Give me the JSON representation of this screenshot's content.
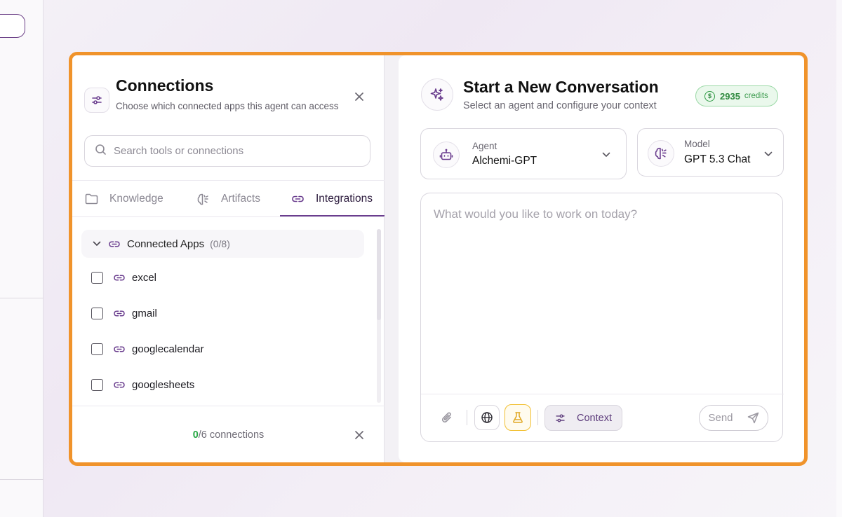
{
  "connections": {
    "title": "Connections",
    "subtitle": "Choose which connected apps this agent can access",
    "search_placeholder": "Search tools or connections",
    "tabs": [
      {
        "label": "Knowledge",
        "icon": "folder-icon",
        "active": false
      },
      {
        "label": "Artifacts",
        "icon": "brain-icon",
        "active": false
      },
      {
        "label": "Integrations",
        "icon": "link-icon",
        "active": true
      }
    ],
    "group": {
      "label": "Connected Apps",
      "count": "(0/8)",
      "expanded": true
    },
    "apps": [
      {
        "name": "excel",
        "checked": false
      },
      {
        "name": "gmail",
        "checked": false
      },
      {
        "name": "googlecalendar",
        "checked": false
      },
      {
        "name": "googlesheets",
        "checked": false
      }
    ],
    "footer": {
      "selected": "0",
      "total_text": "/6 connections"
    }
  },
  "conversation": {
    "title": "Start a New Conversation",
    "subtitle": "Select an agent and configure your context",
    "credits": {
      "amount": "2935",
      "label": "credits",
      "coin_symbol": "$"
    },
    "agent": {
      "label": "Agent",
      "value": "Alchemi-GPT"
    },
    "model": {
      "label": "Model",
      "value": "GPT 5.3 Chat"
    },
    "prompt_placeholder": "What would you like to work on today?",
    "context_label": "Context",
    "send_label": "Send"
  },
  "colors": {
    "highlight": "#f0932b",
    "accent": "#6a3d8e",
    "credits_green": "#2f8a3f",
    "flask_yellow": "#f2c033"
  }
}
